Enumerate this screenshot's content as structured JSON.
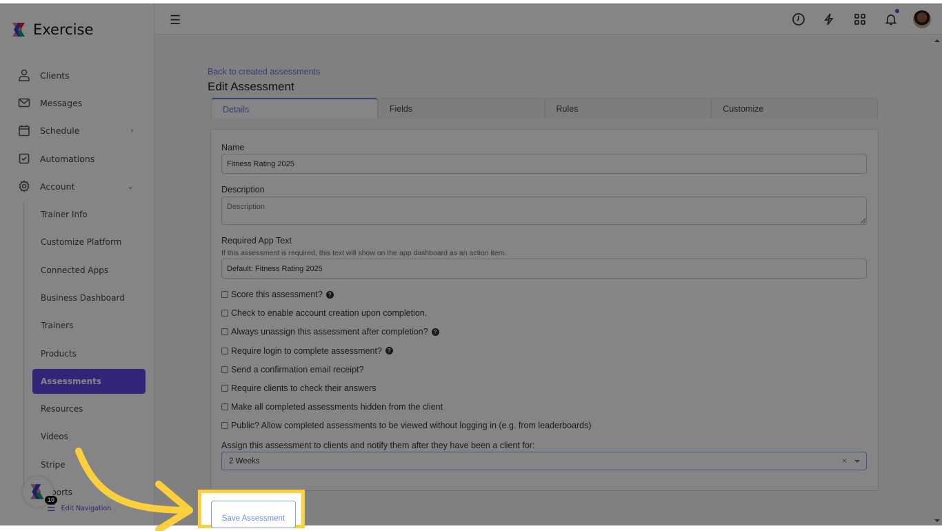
{
  "brand": {
    "name": "Exercise"
  },
  "sidebar": {
    "items": [
      {
        "label": "Clients",
        "icon": "user-icon"
      },
      {
        "label": "Messages",
        "icon": "mail-icon"
      },
      {
        "label": "Schedule",
        "icon": "calendar-icon"
      },
      {
        "label": "Automations",
        "icon": "checkbox-icon"
      },
      {
        "label": "Account",
        "icon": "gear-icon"
      }
    ],
    "sub_items": [
      "Trainer Info",
      "Customize Platform",
      "Connected Apps",
      "Business Dashboard",
      "Trainers",
      "Products",
      "Assessments",
      "Resources",
      "Videos",
      "Stripe",
      "Reports"
    ],
    "active": "Assessments",
    "edit_nav": "Edit Navigation",
    "badge_count": "10"
  },
  "header": {
    "icons": [
      "clock-icon",
      "lightning-icon",
      "apps-grid-icon",
      "bell-icon",
      "avatar"
    ]
  },
  "main": {
    "back_link": "Back to created assessments",
    "title": "Edit Assessment",
    "tabs": [
      {
        "label": "Details"
      },
      {
        "label": "Fields"
      },
      {
        "label": "Rules"
      },
      {
        "label": "Customize"
      }
    ],
    "name_label": "Name",
    "name_value": "Fitness Rating 2025",
    "desc_label": "Description",
    "desc_placeholder": "Description",
    "app_text_label": "Required App Text",
    "app_text_help": "If this assessment is required, this text will show on the app dashboard as an action item.",
    "app_text_value": "Default: Fitness Rating 2025",
    "checkboxes": [
      {
        "label": "Score this assessment?",
        "help": true,
        "checked": false
      },
      {
        "label": "Check to enable account creation upon completion.",
        "help": false,
        "checked": false
      },
      {
        "label": "Always unassign this assessment after completion?",
        "help": true,
        "checked": false
      },
      {
        "label": "Require login to complete assessment?",
        "help": true,
        "checked": false
      },
      {
        "label": "Send a confirmation email receipt?",
        "help": false,
        "checked": false
      },
      {
        "label": "Require clients to check their answers",
        "help": false,
        "checked": false
      },
      {
        "label": "Make all completed assessments hidden from the client",
        "help": false,
        "checked": false
      },
      {
        "label": "Public? Allow completed assessments to be viewed without logging in (e.g. from leaderboards)",
        "help": false,
        "checked": false
      }
    ],
    "assign_label": "Assign this assessment to clients and notify them after they have been a client for:",
    "assign_value": "2 Weeks",
    "clear": "×",
    "save_label": "Save Assessment"
  },
  "colors": {
    "accent": "#6148e8",
    "link": "#5b7ed6",
    "highlight": "#fcd03d"
  }
}
